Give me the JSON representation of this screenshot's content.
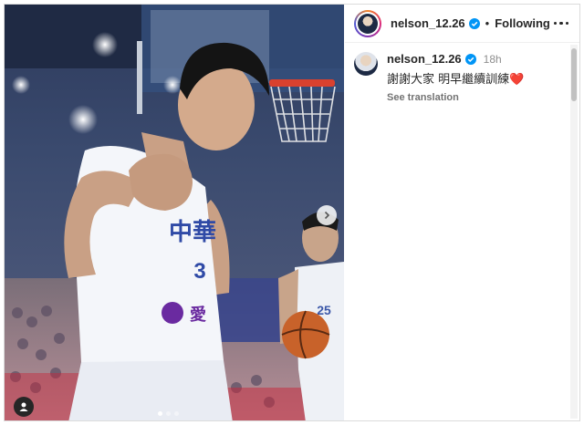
{
  "post": {
    "username": "nelson_12.26",
    "follow_state": "Following",
    "separator": "•",
    "more_icon": "more-horizontal-icon"
  },
  "caption": {
    "username": "nelson_12.26",
    "time": "18h",
    "text": "謝謝大家 明早繼續訓練",
    "emoji": "❤️",
    "see_translation": "See translation"
  },
  "photo": {
    "jersey_number": "3",
    "jersey_team": "中華",
    "sponsor": "愛",
    "background_player_number": "25",
    "carousel_count": 3,
    "carousel_active_index": 0
  },
  "colors": {
    "verified": "#0095f6",
    "text": "#262626",
    "secondary": "#8e8e8e"
  }
}
